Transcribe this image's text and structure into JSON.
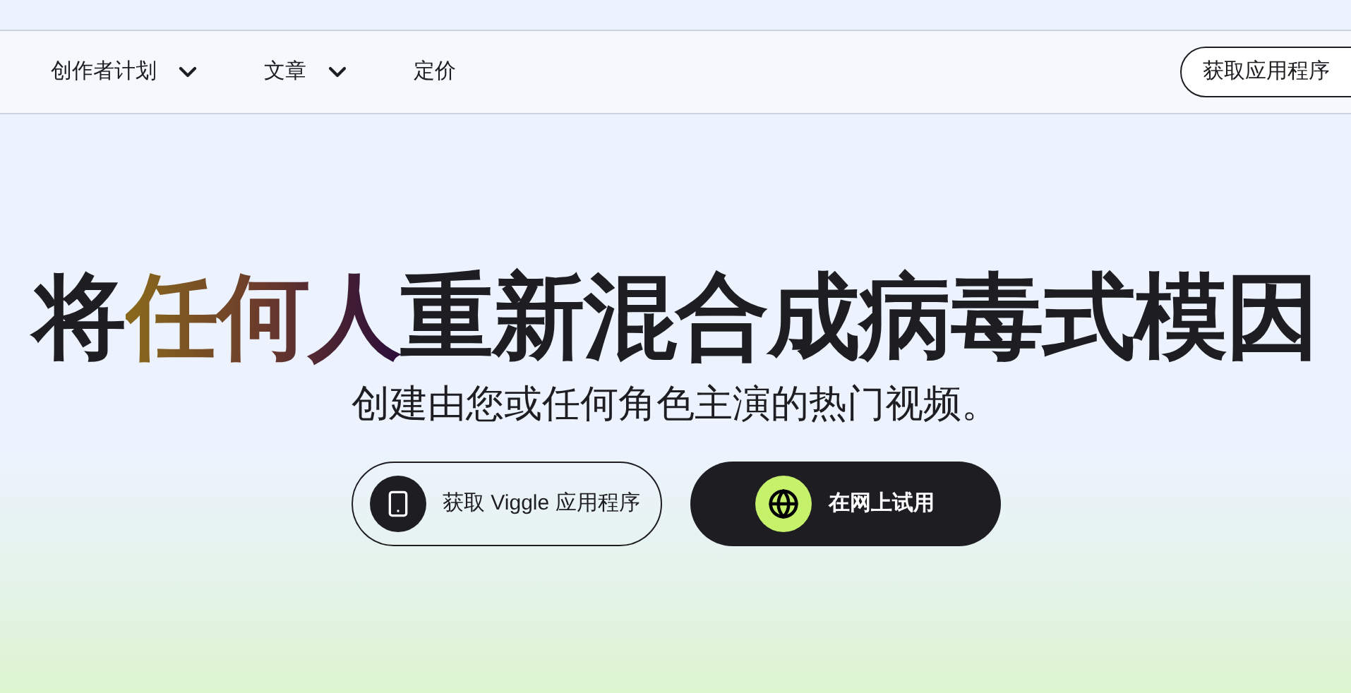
{
  "nav": {
    "items": [
      {
        "label": "创作者计划",
        "has_menu": true
      },
      {
        "label": "文章",
        "has_menu": true
      },
      {
        "label": "定价",
        "has_menu": false
      }
    ],
    "cta": "获取应用程序"
  },
  "hero": {
    "headline_start": "将",
    "headline_highlight": "任何人",
    "headline_end": "重新混合成病毒式模因",
    "subtitle": "创建由您或任何角色主演的热门视频。",
    "buttons": [
      {
        "kind": "outline",
        "label": "获取 Viggle 应用程序"
      },
      {
        "kind": "dark",
        "label": "在网上试用"
      }
    ]
  }
}
